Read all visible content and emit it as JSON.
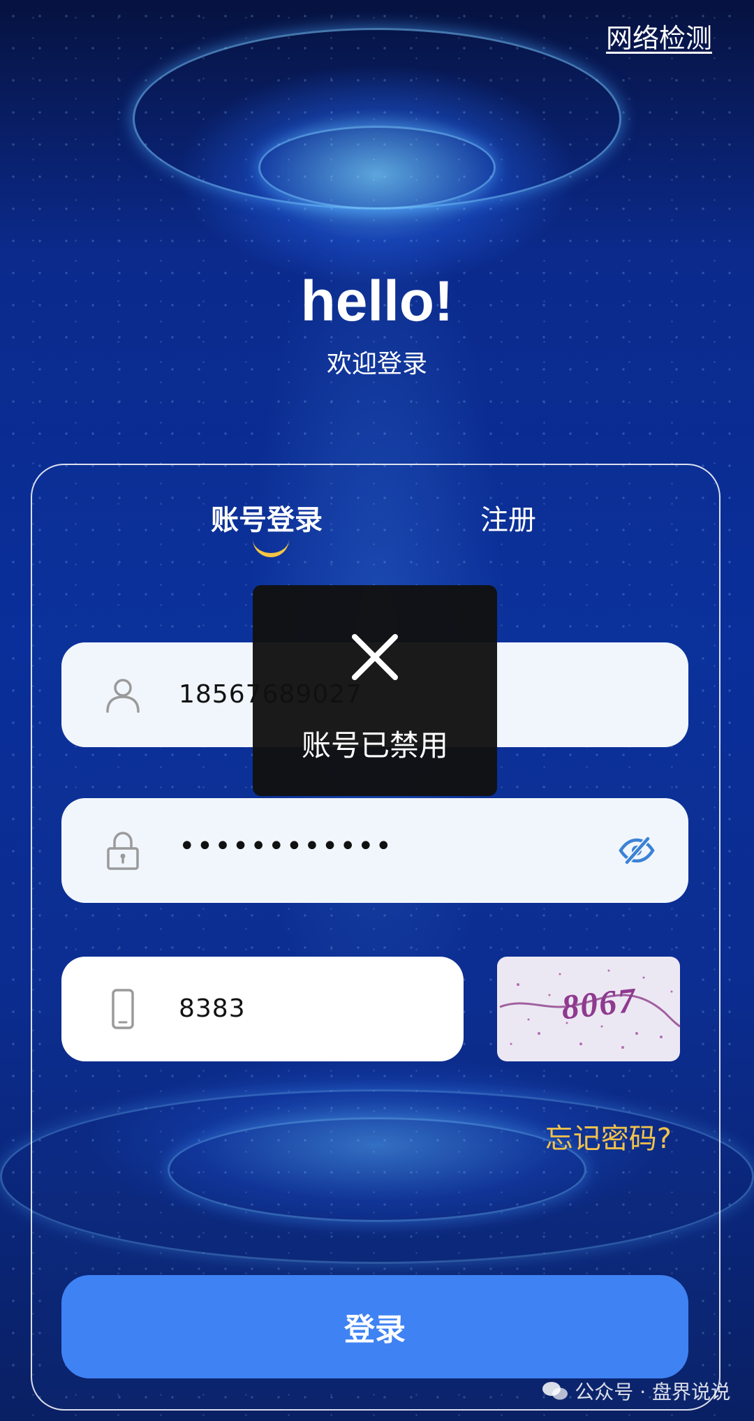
{
  "header": {
    "network_check": "网络检测"
  },
  "hero": {
    "title": "hello!",
    "subtitle": "欢迎登录"
  },
  "tabs": [
    {
      "label": "账号登录",
      "active": true
    },
    {
      "label": "注册",
      "active": false
    }
  ],
  "form": {
    "account": {
      "value": "18567689027",
      "icon": "user-icon"
    },
    "password": {
      "value": "••••••••••••",
      "icon": "lock-icon",
      "toggle_icon": "eye-off-icon"
    },
    "captcha": {
      "value": "8383",
      "icon": "phone-icon",
      "image_text": "8067"
    }
  },
  "forgot_password": "忘记密码?",
  "login_button": "登录",
  "toast": {
    "icon": "close-icon",
    "message": "账号已禁用"
  },
  "watermark": {
    "text": "公众号 · 盘界说说"
  },
  "colors": {
    "accent": "#3f82f3",
    "highlight": "#f2c24b",
    "toast_bg": "#111111"
  }
}
